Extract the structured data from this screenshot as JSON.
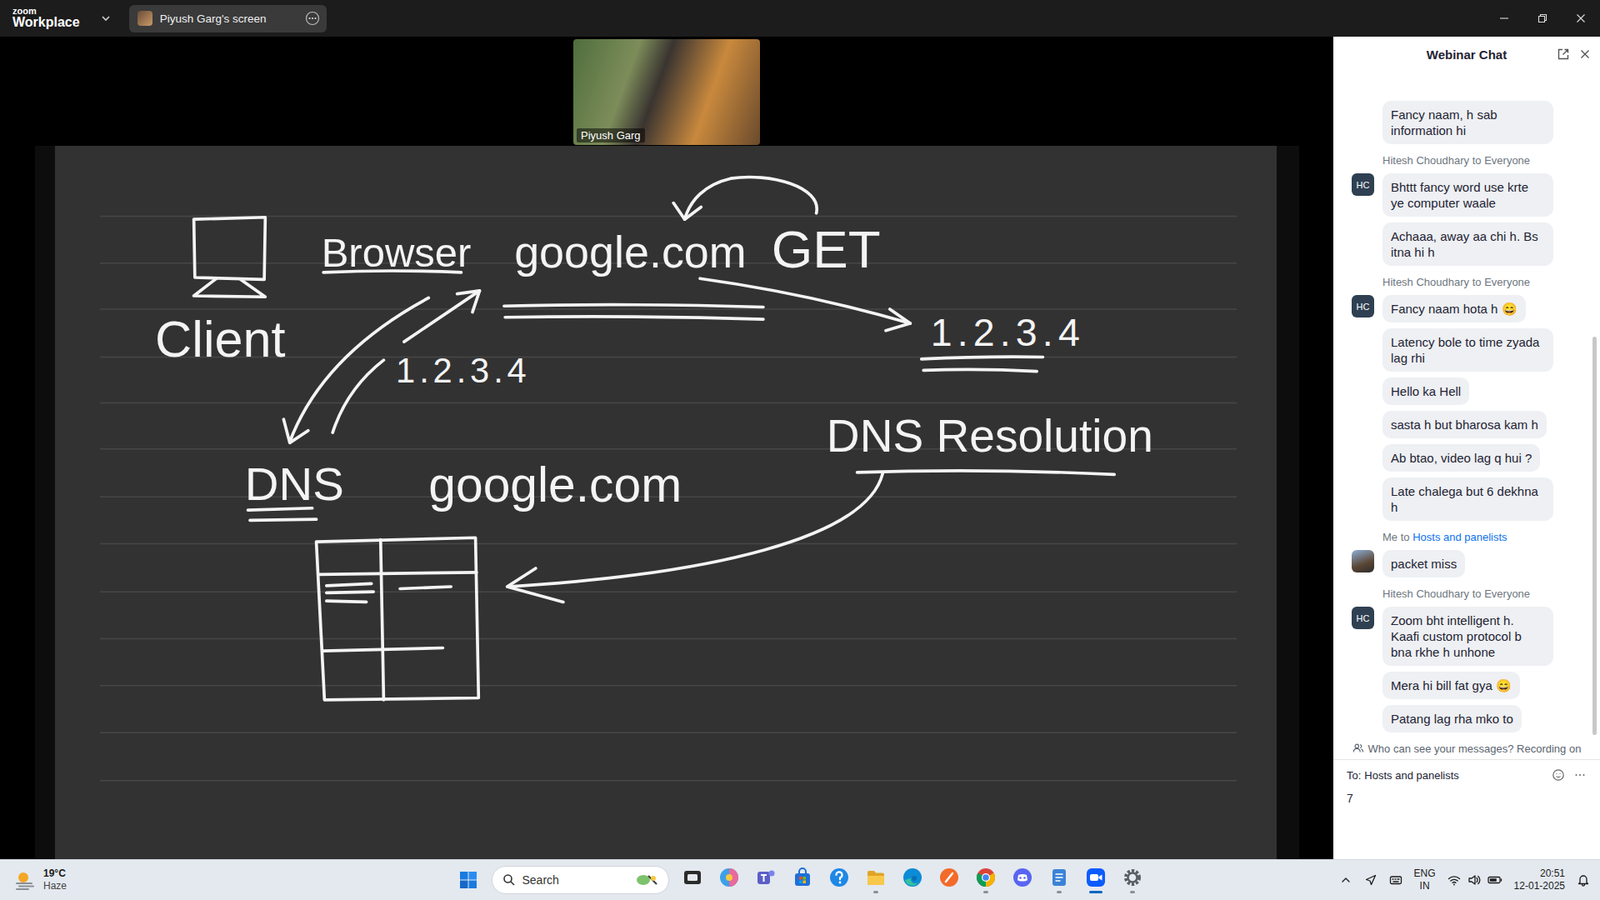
{
  "app": {
    "logo_top": "zoom",
    "logo_bottom": "Workplace",
    "share_tab": "Piyush Garg's screen"
  },
  "video": {
    "name": "Piyush Garg"
  },
  "whiteboard": {
    "client": "Client",
    "browser": "Browser",
    "request_host": "google.com",
    "method": "GET",
    "response_ip": "1.2.3.4",
    "resolved_ip": "1.2.3.4",
    "dns": "DNS",
    "dns_query": "google.com",
    "process": "DNS Resolution"
  },
  "chat": {
    "title": "Webinar Chat",
    "groups": [
      {
        "kind": "continuation",
        "messages": [
          "Fancy naam, h sab information hi"
        ]
      },
      {
        "kind": "initials",
        "avatar": "HC",
        "sender": "Hitesh Choudhary",
        "joiner": "to",
        "recipient": "Everyone",
        "recipient_link": false,
        "messages": [
          "Bhttt fancy word use krte ye computer waale",
          "Achaaa, away aa chi h. Bs itna hi h"
        ]
      },
      {
        "kind": "initials",
        "avatar": "HC",
        "sender": "Hitesh Choudhary",
        "joiner": "to",
        "recipient": "Everyone",
        "recipient_link": false,
        "messages": [
          "Fancy naam hota h 😄",
          "Latency bole to time zyada lag rhi",
          "Hello ka Hell",
          "sasta h but bharosa kam h",
          "Ab btao, video lag q hui ?",
          "Late chalega but 6 dekhna h"
        ]
      },
      {
        "kind": "photo",
        "sender": "Me",
        "joiner": "to",
        "recipient": "Hosts and panelists",
        "recipient_link": true,
        "messages": [
          "packet miss"
        ]
      },
      {
        "kind": "initials",
        "avatar": "HC",
        "sender": "Hitesh Choudhary",
        "joiner": "to",
        "recipient": "Everyone",
        "recipient_link": false,
        "messages": [
          "Zoom bht intelligent h. Kaafi custom protocol b bna rkhe h unhone",
          "Mera hi bill fat gya 😄",
          "Patang lag rha mko to"
        ]
      }
    ],
    "notice": "Who can see your messages? Recording on",
    "to_label": "To:",
    "to_value": "Hosts and panelists",
    "input": "7"
  },
  "taskbar": {
    "temp": "19°C",
    "weather": "Haze",
    "search": "Search",
    "lang": "ENG",
    "region": "IN",
    "time": "20:51",
    "date": "12-01-2025",
    "apps": [
      {
        "running": false,
        "active": false
      },
      {
        "running": false,
        "active": false
      },
      {
        "running": false,
        "active": false
      },
      {
        "running": false,
        "active": false
      },
      {
        "running": false,
        "active": false
      },
      {
        "running": true,
        "active": false
      },
      {
        "running": false,
        "active": false
      },
      {
        "running": false,
        "active": false
      },
      {
        "running": true,
        "active": false
      },
      {
        "running": false,
        "active": false
      },
      {
        "running": true,
        "active": false
      },
      {
        "running": true,
        "active": true
      },
      {
        "running": true,
        "active": false
      }
    ]
  }
}
